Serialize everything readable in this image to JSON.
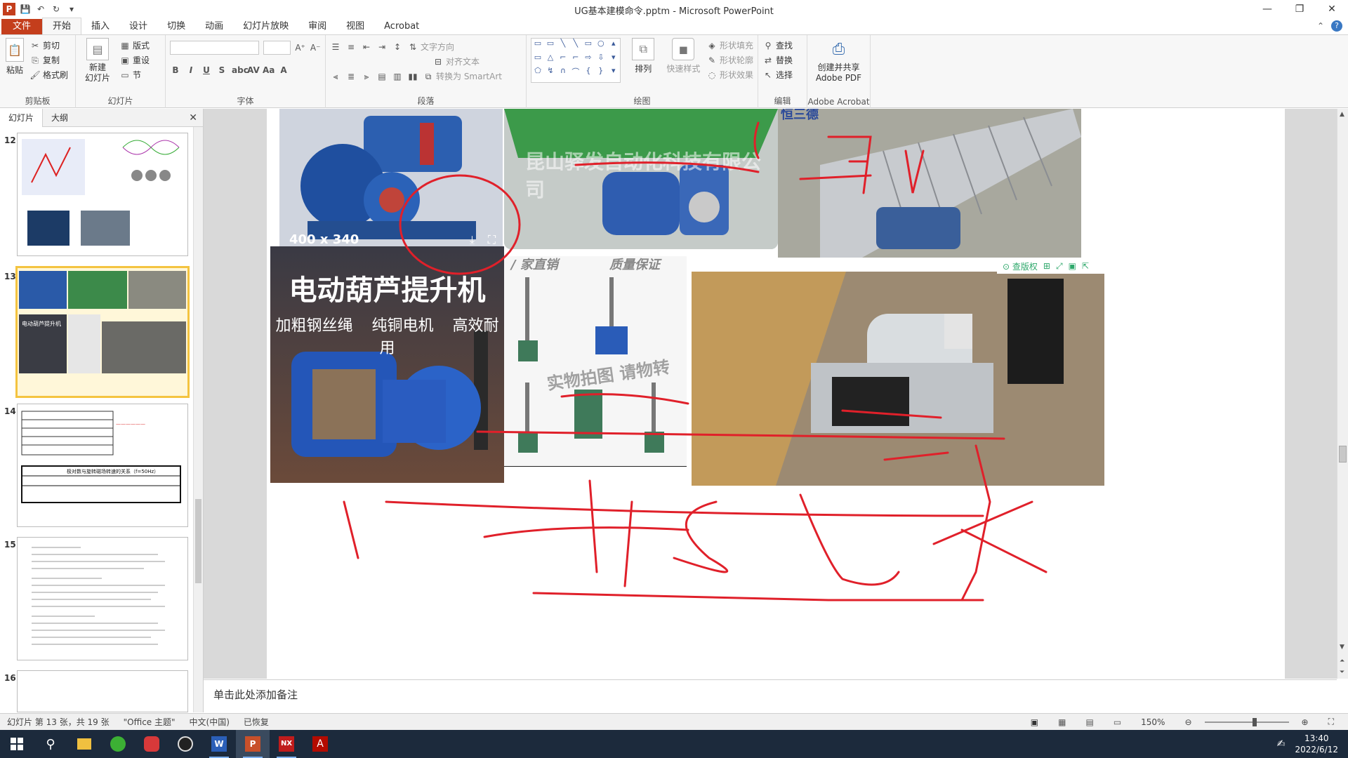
{
  "app": {
    "logo": "P",
    "window_title": "UG基本建模命令.pptm - Microsoft PowerPoint"
  },
  "ribbon_tabs": [
    "文件",
    "开始",
    "插入",
    "设计",
    "切换",
    "动画",
    "幻灯片放映",
    "审阅",
    "视图",
    "Acrobat"
  ],
  "ribbon": {
    "clipboard": {
      "paste": "粘贴",
      "cut": "剪切",
      "copy": "复制",
      "format_painter": "格式刷",
      "label": "剪贴板"
    },
    "slides": {
      "new_slide": "新建\n幻灯片",
      "layout": "版式",
      "reset": "重设",
      "section": "节",
      "label": "幻灯片"
    },
    "font": {
      "label": "字体"
    },
    "paragraph": {
      "text_direction": "文字方向",
      "align_text": "对齐文本",
      "convert_smartart": "转换为 SmartArt",
      "label": "段落"
    },
    "drawing": {
      "arrange": "排列",
      "quick_styles": "快速样式",
      "shape_fill": "形状填充",
      "shape_outline": "形状轮廓",
      "shape_effects": "形状效果",
      "label": "绘图"
    },
    "editing": {
      "find": "查找",
      "replace": "替换",
      "select": "选择",
      "label": "编辑"
    },
    "acrobat": {
      "create_share": "创建并共享\nAdobe PDF",
      "label": "Adobe Acrobat"
    }
  },
  "panel": {
    "tabs": [
      "幻灯片",
      "大纲"
    ],
    "thumbnails": [
      {
        "number": "12"
      },
      {
        "number": "13",
        "caption": "电动葫芦提升机"
      },
      {
        "number": "14",
        "caption": "极对数与旋转磁场转速的关系（f=50Hz）"
      },
      {
        "number": "15"
      },
      {
        "number": "16"
      }
    ]
  },
  "slide": {
    "size_label": "400 x 340",
    "hoist_title": "电动葫芦提升机",
    "hoist_subtitle": "加粗钢丝绳 纯铜电机 高效耐用",
    "watermark_1": "昆山驿发自动化科技有限公司",
    "watermark_2": "实物拍图 请物转",
    "header_fragment_1": "/ 家直销",
    "header_fragment_2": "质量保证",
    "header_fragment_3": "恒三德",
    "img_toolbar_label": "查版权"
  },
  "notes_placeholder": "单击此处添加备注",
  "status": {
    "slide_info": "幻灯片 第 13 张，共 19 张",
    "theme": "\"Office 主题\"",
    "language": "中文(中国)",
    "recovered": "已恢复",
    "zoom": "150%"
  },
  "taskbar": {
    "time": "13:40",
    "date": "2022/6/12",
    "apps": [
      "start",
      "search",
      "file-explorer",
      "wechat",
      "netease-music",
      "obs",
      "word",
      "powerpoint",
      "nx",
      "acrobat"
    ]
  },
  "colors": {
    "accent": "#c43e1c",
    "selected_thumb": "#f4c440",
    "ink": "#e0202a"
  }
}
